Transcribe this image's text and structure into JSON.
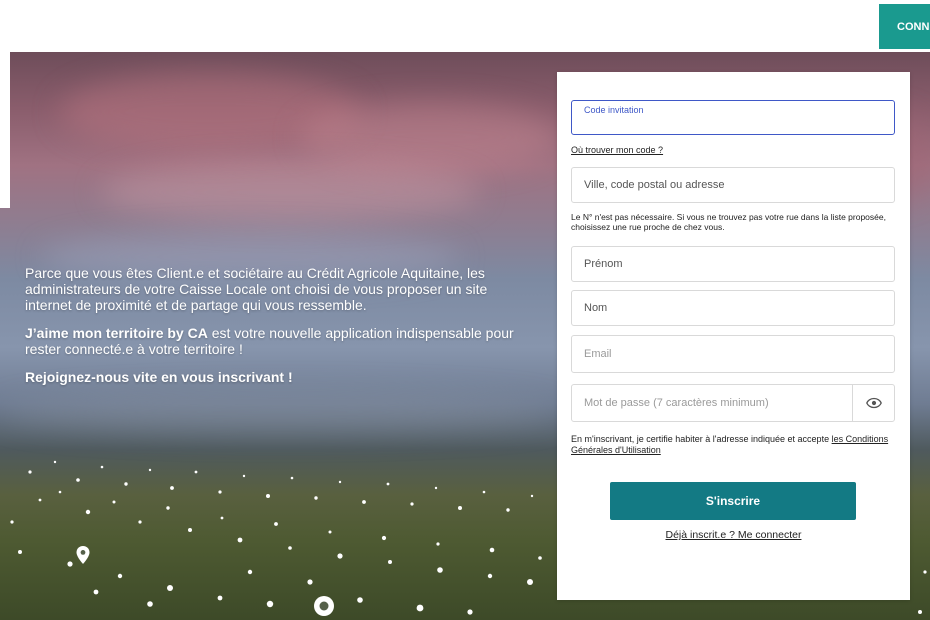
{
  "header": {
    "connect_label": "CONNEXION"
  },
  "intro": {
    "paragraph1": "Parce que vous êtes Client.e et sociétaire au Crédit Agricole Aquitaine, les administrateurs de votre Caisse Locale ont choisi de vous proposer un site internet de proximité et de partage qui vous ressemble.",
    "paragraph2_bold": "J’aime mon territoire by CA",
    "paragraph2_rest": " est votre nouvelle application indispensable pour rester connecté.e à votre territoire !",
    "paragraph3": "Rejoignez-nous vite en vous inscrivant !"
  },
  "form": {
    "code_label": "Code invitation",
    "code_help_link": "Où trouver mon code ?",
    "address_placeholder": "Ville, code postal ou adresse",
    "address_hint": "Le N° n'est pas nécessaire. Si vous ne trouvez pas votre rue dans la liste proposée, choisissez une rue proche de chez vous.",
    "firstname_placeholder": "Prénom",
    "lastname_placeholder": "Nom",
    "email_placeholder": "Email",
    "password_placeholder": "Mot de passe (7 caractères minimum)",
    "password_toggle_icon": "eye-icon",
    "terms_text": "En m'inscrivant, je certifie habiter à l'adresse indiquée et accepte ",
    "terms_link": "les Conditions Générales d'Utilisation",
    "submit_label": "S'inscrire",
    "login_link": "Déjà inscrit.e ? Me connecter"
  },
  "colors": {
    "accent": "#137a84",
    "connect": "#1a9a8f",
    "focus": "#3f58c7"
  }
}
